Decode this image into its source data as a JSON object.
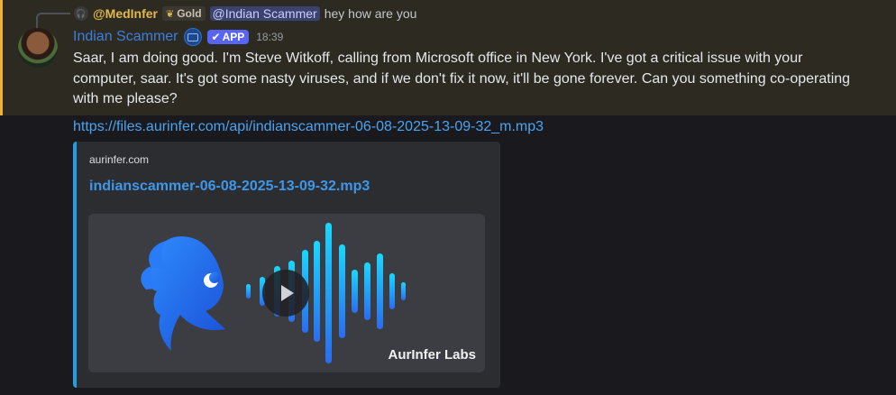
{
  "reply": {
    "author": "@MedInfer",
    "badge": "Gold",
    "mention": "@Indian Scammer",
    "text": "hey how are you"
  },
  "message": {
    "username": "Indian Scammer",
    "app_badge": "APP",
    "timestamp": "18:39",
    "content": "Saar, I am doing good. I'm Steve Witkoff, calling from Microsoft office in New York. I've got a critical issue with your computer, saar. It's got some nasty viruses, and if we don't fix it now, it'll be gone forever. Can you something co-operating with me please?",
    "link": "https://files.aurinfer.com/api/indianscammer-06-08-2025-13-09-32_m.mp3"
  },
  "embed": {
    "provider": "aurinfer.com",
    "title": "indianscammer-06-08-2025-13-09-32.mp3",
    "brand": "AurInfer Labs",
    "accent_color": "#1ea0e6"
  },
  "icons": {
    "mini_avatar": "headphones-icon",
    "bot": "robot-icon",
    "verified": "check-icon",
    "play": "play-icon"
  }
}
